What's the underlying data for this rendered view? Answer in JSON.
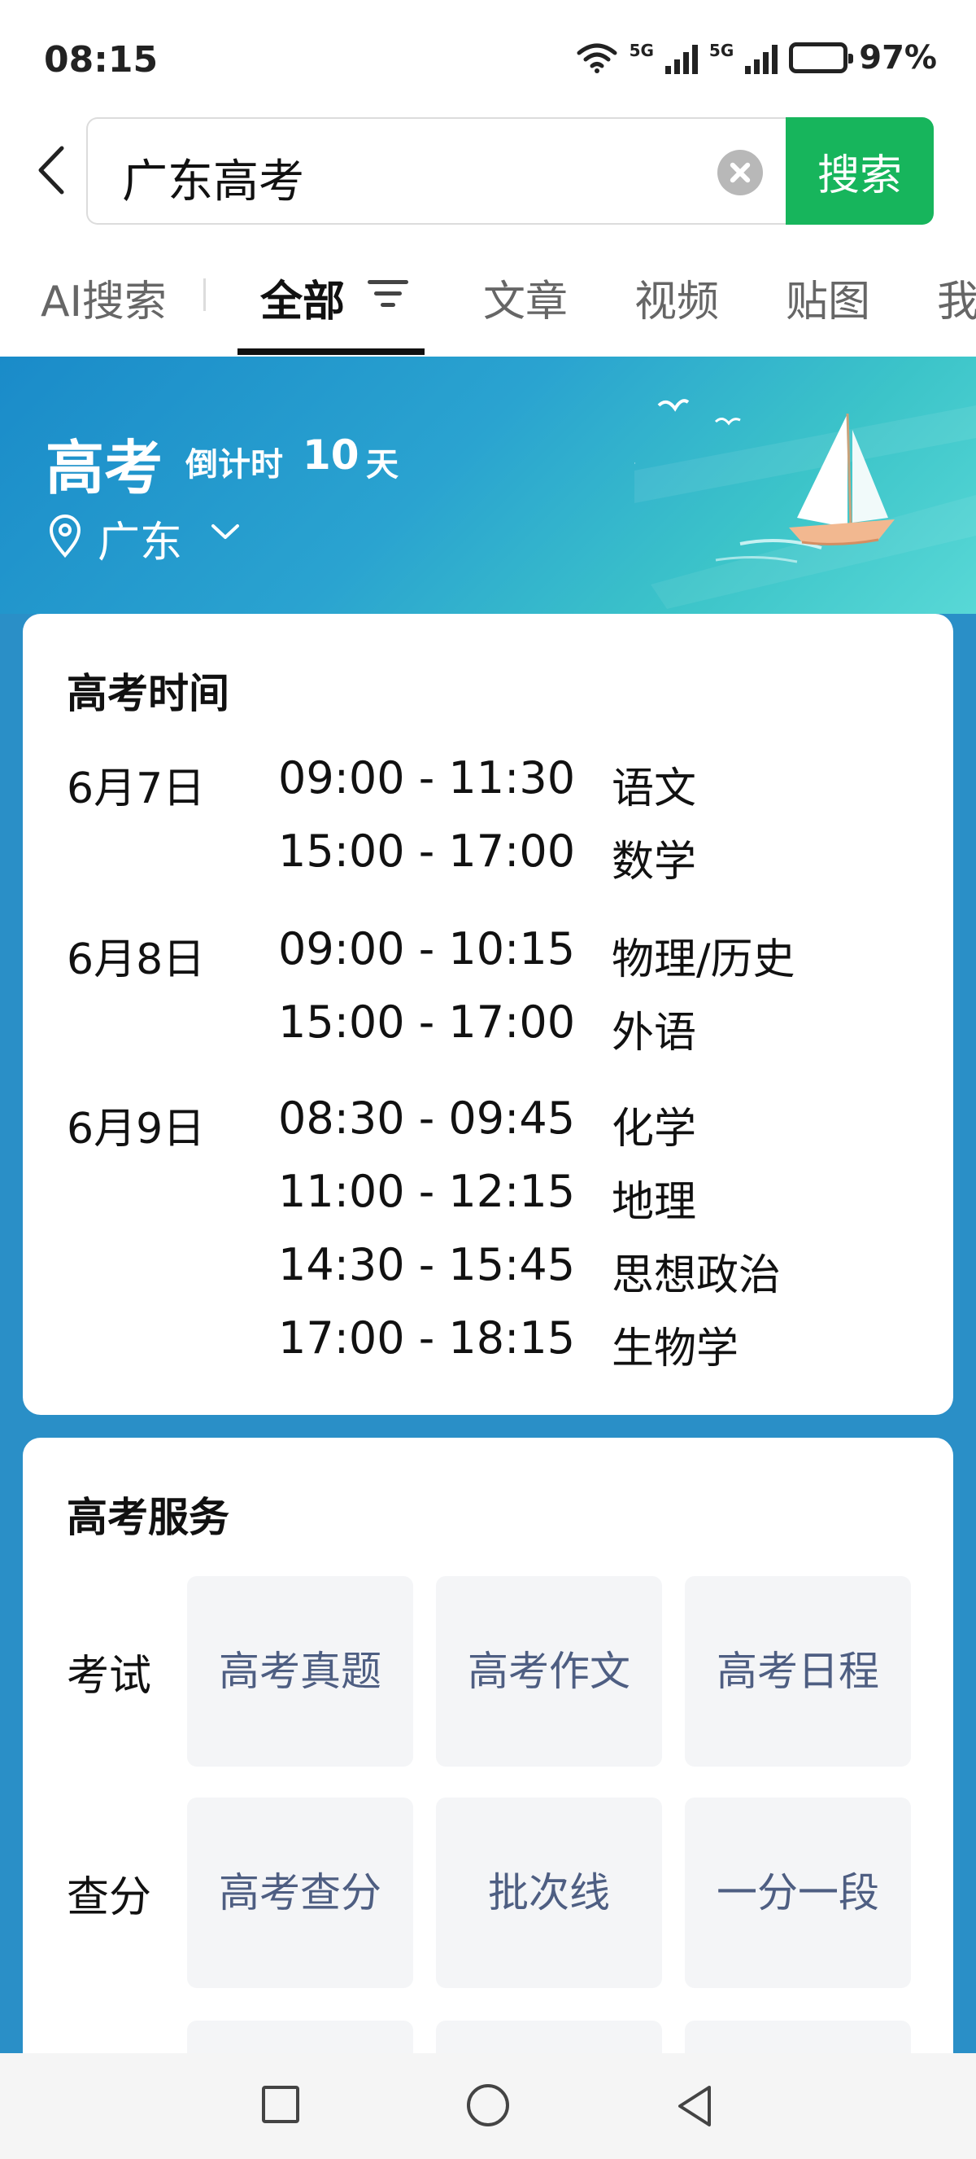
{
  "status_bar": {
    "time": "08:15",
    "network_1": "5G",
    "network_2": "5G",
    "battery": "97%",
    "battery_level": 0.97
  },
  "search": {
    "query": "广东高考",
    "button": "搜索"
  },
  "tabs": [
    {
      "label": "AI搜索",
      "active": false
    },
    {
      "label": "全部",
      "active": true
    },
    {
      "label": "文章",
      "active": false
    },
    {
      "label": "视频",
      "active": false
    },
    {
      "label": "贴图",
      "active": false
    },
    {
      "label": "我",
      "active": false
    }
  ],
  "banner": {
    "title": "高考",
    "countdown_label": "倒计时",
    "countdown_days": "10",
    "countdown_unit": "天",
    "location": "广东"
  },
  "schedule": {
    "title": "高考时间",
    "days": [
      {
        "date": "6月7日",
        "sessions": [
          {
            "time": "09:00 - 11:30",
            "subject": "语文"
          },
          {
            "time": "15:00 - 17:00",
            "subject": "数学"
          }
        ]
      },
      {
        "date": "6月8日",
        "sessions": [
          {
            "time": "09:00 - 10:15",
            "subject": "物理/历史"
          },
          {
            "time": "15:00 - 17:00",
            "subject": "外语"
          }
        ]
      },
      {
        "date": "6月9日",
        "sessions": [
          {
            "time": "08:30 - 09:45",
            "subject": "化学"
          },
          {
            "time": "11:00 - 12:15",
            "subject": "地理"
          },
          {
            "time": "14:30 - 15:45",
            "subject": "思想政治"
          },
          {
            "time": "17:00 - 18:15",
            "subject": "生物学"
          }
        ]
      }
    ]
  },
  "services": {
    "title": "高考服务",
    "rows": [
      {
        "label": "考试",
        "items": [
          "高考真题",
          "高考作文",
          "高考日程"
        ]
      },
      {
        "label": "查分",
        "items": [
          "高考查分",
          "批次线",
          "一分一段"
        ]
      }
    ]
  },
  "colors": {
    "accent_green": "#17b55c",
    "banner_blue": "#1a8bc9",
    "tile_text": "#4e5e82"
  }
}
